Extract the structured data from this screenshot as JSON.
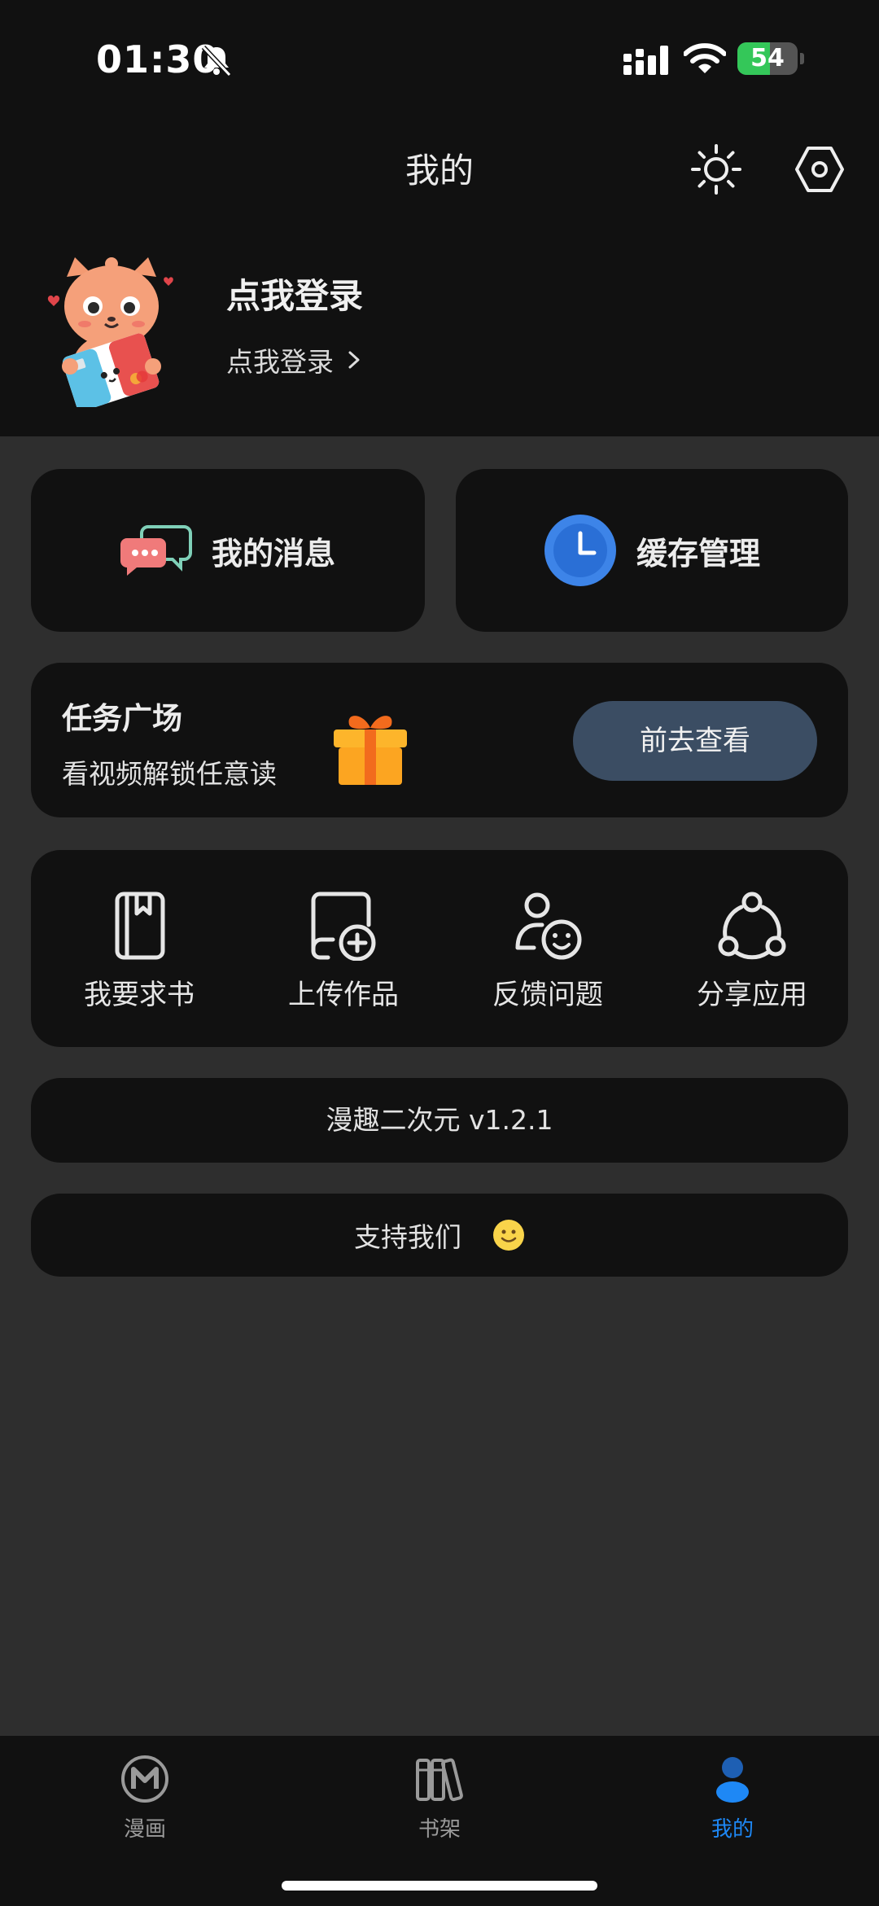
{
  "status_bar": {
    "time": "01:30",
    "battery_level": "54",
    "battery_fraction": 0.54,
    "icons": [
      "bell-muted-icon",
      "signal-icon",
      "wifi-icon",
      "battery-charging-icon"
    ]
  },
  "header": {
    "title": "我的",
    "icons": [
      "sun-icon",
      "settings-hexagon-icon"
    ]
  },
  "profile": {
    "title": "点我登录",
    "subtitle": "点我登录"
  },
  "quick_cards": [
    {
      "label": "我的消息",
      "icon": "chat-bubbles-icon"
    },
    {
      "label": "缓存管理",
      "icon": "clock-icon"
    }
  ],
  "task": {
    "title": "任务广场",
    "subtitle": "看视频解锁任意读",
    "button": "前去查看",
    "icon": "gift-icon"
  },
  "tools": [
    {
      "label": "我要求书",
      "icon": "book-bookmark-icon"
    },
    {
      "label": "上传作品",
      "icon": "upload-document-icon"
    },
    {
      "label": "反馈问题",
      "icon": "user-feedback-icon"
    },
    {
      "label": "分享应用",
      "icon": "share-icon"
    }
  ],
  "version": "漫趣二次元 v1.2.1",
  "support": {
    "label": "支持我们",
    "icon": "smile-emoji-icon"
  },
  "tabbar": [
    {
      "label": "漫画",
      "icon": "manga-m-icon",
      "active": false
    },
    {
      "label": "书架",
      "icon": "bookshelf-icon",
      "active": false
    },
    {
      "label": "我的",
      "icon": "person-icon",
      "active": true
    }
  ],
  "colors": {
    "background": "#2e2e2e",
    "surface": "#111111",
    "accent": "#1e88f5",
    "button": "#3b4d63",
    "battery": "#34c759"
  }
}
